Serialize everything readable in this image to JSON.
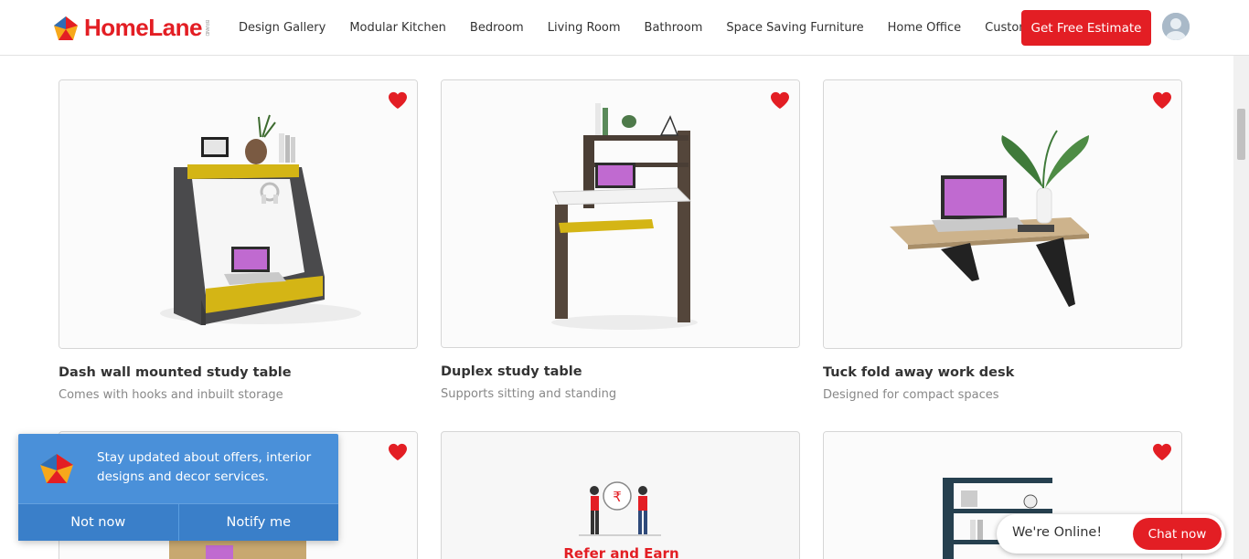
{
  "brand": {
    "name": "HomeLane",
    "sub": "BRAND",
    "color": "#e31e24"
  },
  "nav": {
    "items": [
      {
        "label": "Design Gallery"
      },
      {
        "label": "Modular Kitchen"
      },
      {
        "label": "Bedroom"
      },
      {
        "label": "Living Room"
      },
      {
        "label": "Bathroom"
      },
      {
        "label": "Space Saving Furniture"
      },
      {
        "label": "Home Office"
      },
      {
        "label": "Customer Stories"
      }
    ],
    "cta_label": "Get Free Estimate"
  },
  "cards": [
    {
      "title": "Dash wall mounted study table",
      "subtitle": "Comes with hooks and inbuilt storage",
      "icon": "heart-icon"
    },
    {
      "title": "Duplex study table",
      "subtitle": "Supports sitting and standing",
      "icon": "heart-icon"
    },
    {
      "title": "Tuck fold away work desk",
      "subtitle": "Designed for compact spaces",
      "icon": "heart-icon"
    }
  ],
  "refer": {
    "label": "Refer and Earn",
    "currency_symbol": "₹"
  },
  "notify": {
    "message": "Stay updated about offers, interior designs and decor services.",
    "dismiss_label": "Not now",
    "accept_label": "Notify me",
    "background": "#4a90d9"
  },
  "chat": {
    "status": "We're Online!",
    "button_label": "Chat now"
  },
  "colors": {
    "accent": "#e31e24",
    "heart": "#e31e24"
  }
}
